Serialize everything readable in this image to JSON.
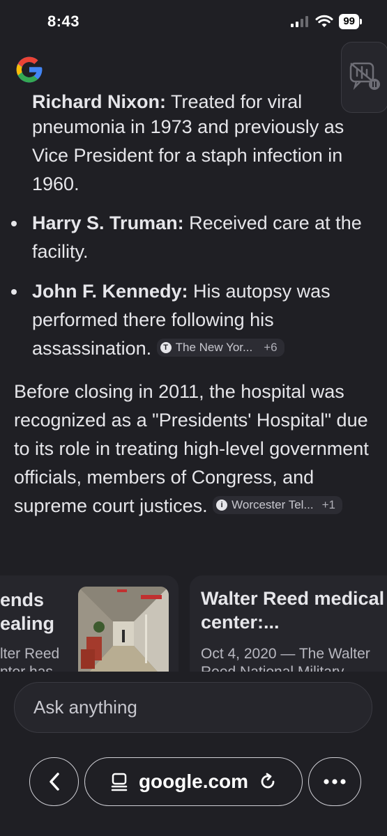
{
  "status": {
    "time": "8:43",
    "battery": "99"
  },
  "answer": {
    "clipped_line": {
      "name": "Richard Nixon:",
      "text": " Treated for viral"
    },
    "nixon_rest": "pneumonia in 1973 and previously as Vice President for a staph infection in 1960.",
    "bullets": [
      {
        "name": "Harry S. Truman:",
        "text": " Received care at the facility."
      },
      {
        "name": "John F. Kennedy:",
        "text": " His autopsy was performed there following his assassination.",
        "source": "The New Yor...",
        "more": "+6"
      }
    ],
    "paragraph": "Before closing in 2011, the hospital was recognized as a \"Presidents' Hospital\" due to its role in treating high-level government officials, members of Congress, and supreme court justices.",
    "paragraph_source": "Worcester Tel...",
    "paragraph_more": "+1"
  },
  "cards": [
    {
      "title_1": "ends",
      "title_2": "ealing",
      "snippet_1": "lter Reed",
      "snippet_2": "nter has"
    },
    {
      "title": "Walter Reed medical center:...",
      "snippet_1": "Oct 4, 2020 — The Walter",
      "snippet_2": "Reed National Military"
    }
  ],
  "ask": {
    "placeholder": "Ask anything"
  },
  "browser": {
    "url": "google.com"
  },
  "icons": {
    "google": "google-g-logo",
    "voice": "voice-mode-icon",
    "back": "chevron-left-icon",
    "tabs": "tab-icon",
    "reload": "reload-icon",
    "more": "more-horizontal-icon"
  }
}
